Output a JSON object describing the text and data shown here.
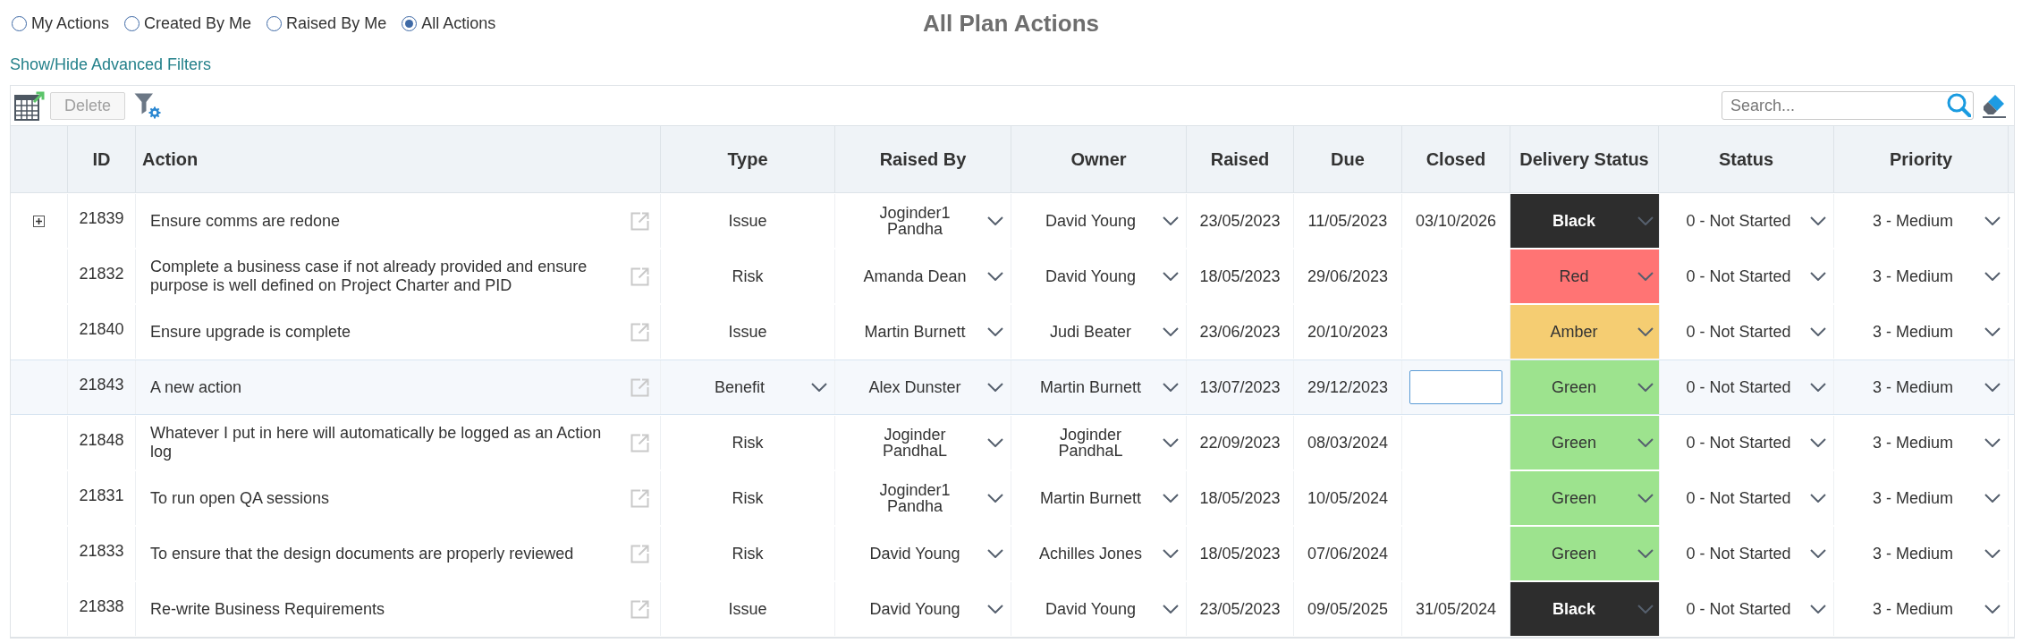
{
  "filters": [
    {
      "label": "My Actions",
      "selected": false
    },
    {
      "label": "Created By Me",
      "selected": false
    },
    {
      "label": "Raised By Me",
      "selected": false
    },
    {
      "label": "All Actions",
      "selected": true
    }
  ],
  "title": "All Plan Actions",
  "advanced_filters_link": "Show/Hide Advanced Filters",
  "toolbar": {
    "delete_button": {
      "label": "Delete",
      "disabled": true
    },
    "search": {
      "placeholder": "Search..."
    }
  },
  "table": {
    "columns": [
      "ID",
      "Action",
      "Type",
      "Raised By",
      "Owner",
      "Raised",
      "Due",
      "Closed",
      "Delivery Status",
      "Status",
      "Priority"
    ],
    "rows": [
      {
        "expandable": true,
        "selected": false,
        "id": "21839",
        "action": "Ensure comms are redone",
        "type": "Issue",
        "raised_by": "Joginder1 Pandha",
        "owner": "David Young",
        "raised": "23/05/2023",
        "due": "11/05/2023",
        "closed": "03/10/2026",
        "delivery_status": {
          "label": "Black",
          "color": "#2d2d2d"
        },
        "status": "0 - Not Started",
        "priority": "3 - Medium"
      },
      {
        "expandable": false,
        "selected": false,
        "id": "21832",
        "action": "Complete a business case if not already provided and ensure purpose is well defined on Project Charter and PID",
        "type": "Risk",
        "raised_by": "Amanda Dean",
        "owner": "David Young",
        "raised": "18/05/2023",
        "due": "29/06/2023",
        "delivery_status": {
          "label": "Red",
          "color": "#ff7474"
        },
        "status": "0 - Not Started",
        "priority": "3 - Medium"
      },
      {
        "expandable": false,
        "selected": false,
        "id": "21840",
        "action": "Ensure upgrade is complete",
        "type": "Issue",
        "raised_by": "Martin Burnett",
        "owner": "Judi Beater",
        "raised": "23/06/2023",
        "due": "20/10/2023",
        "delivery_status": {
          "label": "Amber",
          "color": "#f5cd72"
        },
        "status": "0 - Not Started",
        "priority": "3 - Medium"
      },
      {
        "expandable": false,
        "selected": true,
        "id": "21843",
        "action": "A new action",
        "type": "Benefit",
        "raised_by": "Alex Dunster",
        "owner": "Martin Burnett",
        "raised": "13/07/2023",
        "due": "29/12/2023",
        "delivery_status": {
          "label": "Green",
          "color": "#9de38e"
        },
        "status": "0 - Not Started",
        "priority": "3 - Medium"
      },
      {
        "expandable": false,
        "selected": false,
        "id": "21848",
        "action": "Whatever I put in here will automatically be logged as an Action log",
        "type": "Risk",
        "raised_by": "Joginder PandhaL",
        "owner": "Joginder PandhaL",
        "raised": "22/09/2023",
        "due": "08/03/2024",
        "delivery_status": {
          "label": "Green",
          "color": "#9de38e"
        },
        "status": "0 - Not Started",
        "priority": "3 - Medium"
      },
      {
        "expandable": false,
        "selected": false,
        "id": "21831",
        "action": "To run open QA sessions",
        "type": "Risk",
        "raised_by": "Joginder1 Pandha",
        "owner": "Martin Burnett",
        "raised": "18/05/2023",
        "due": "10/05/2024",
        "delivery_status": {
          "label": "Green",
          "color": "#9de38e"
        },
        "status": "0 - Not Started",
        "priority": "3 - Medium"
      },
      {
        "expandable": false,
        "selected": false,
        "id": "21833",
        "action": "To ensure that the design documents are properly reviewed",
        "type": "Risk",
        "raised_by": "David Young",
        "owner": "Achilles Jones",
        "raised": "18/05/2023",
        "due": "07/06/2024",
        "delivery_status": {
          "label": "Green",
          "color": "#9de38e"
        },
        "status": "0 - Not Started",
        "priority": "3 - Medium"
      },
      {
        "expandable": false,
        "selected": false,
        "id": "21838",
        "action": "Re-write Business Requirements",
        "type": "Issue",
        "raised_by": "David Young",
        "owner": "David Young",
        "raised": "23/05/2023",
        "due": "09/05/2025",
        "closed": "31/05/2024",
        "delivery_status": {
          "label": "Black",
          "color": "#2d2d2d"
        },
        "status": "0 - Not Started",
        "priority": "3 - Medium"
      }
    ]
  }
}
